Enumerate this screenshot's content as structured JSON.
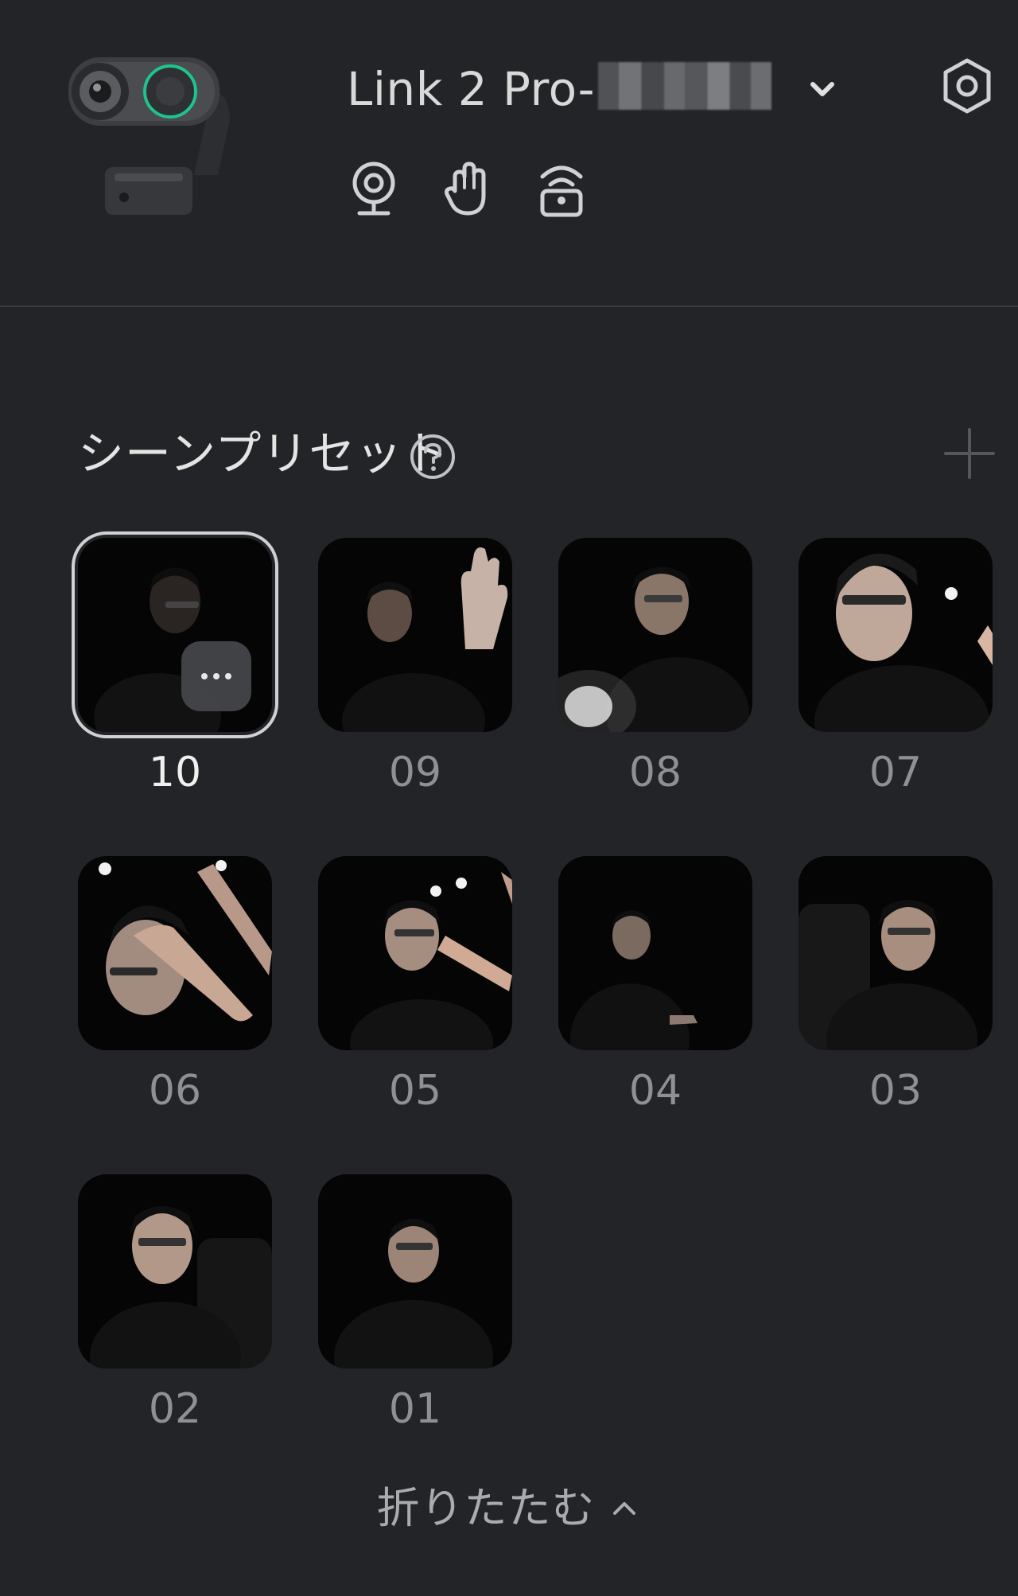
{
  "header": {
    "device_name": "Link 2 Pro-",
    "mode_icons": [
      "webcam-icon",
      "hand-gesture-icon",
      "wireless-signal-icon"
    ],
    "settings_icon": "gear-hex-icon",
    "dropdown_icon": "chevron-down-icon"
  },
  "scene_presets": {
    "title": "シーンプリセット",
    "help_icon": "question-circle-icon",
    "add_icon": "plus-icon",
    "presets": [
      {
        "label": "10",
        "selected": true
      },
      {
        "label": "09",
        "selected": false
      },
      {
        "label": "08",
        "selected": false
      },
      {
        "label": "07",
        "selected": false
      },
      {
        "label": "06",
        "selected": false
      },
      {
        "label": "05",
        "selected": false
      },
      {
        "label": "04",
        "selected": false
      },
      {
        "label": "03",
        "selected": false
      },
      {
        "label": "02",
        "selected": false
      },
      {
        "label": "01",
        "selected": false
      }
    ],
    "more_icon": "ellipsis-icon",
    "collapse_label": "折りたたむ"
  },
  "colors": {
    "background": "#232427",
    "accent_green": "#1ec48c",
    "selected_border": "#cfd1d4"
  }
}
